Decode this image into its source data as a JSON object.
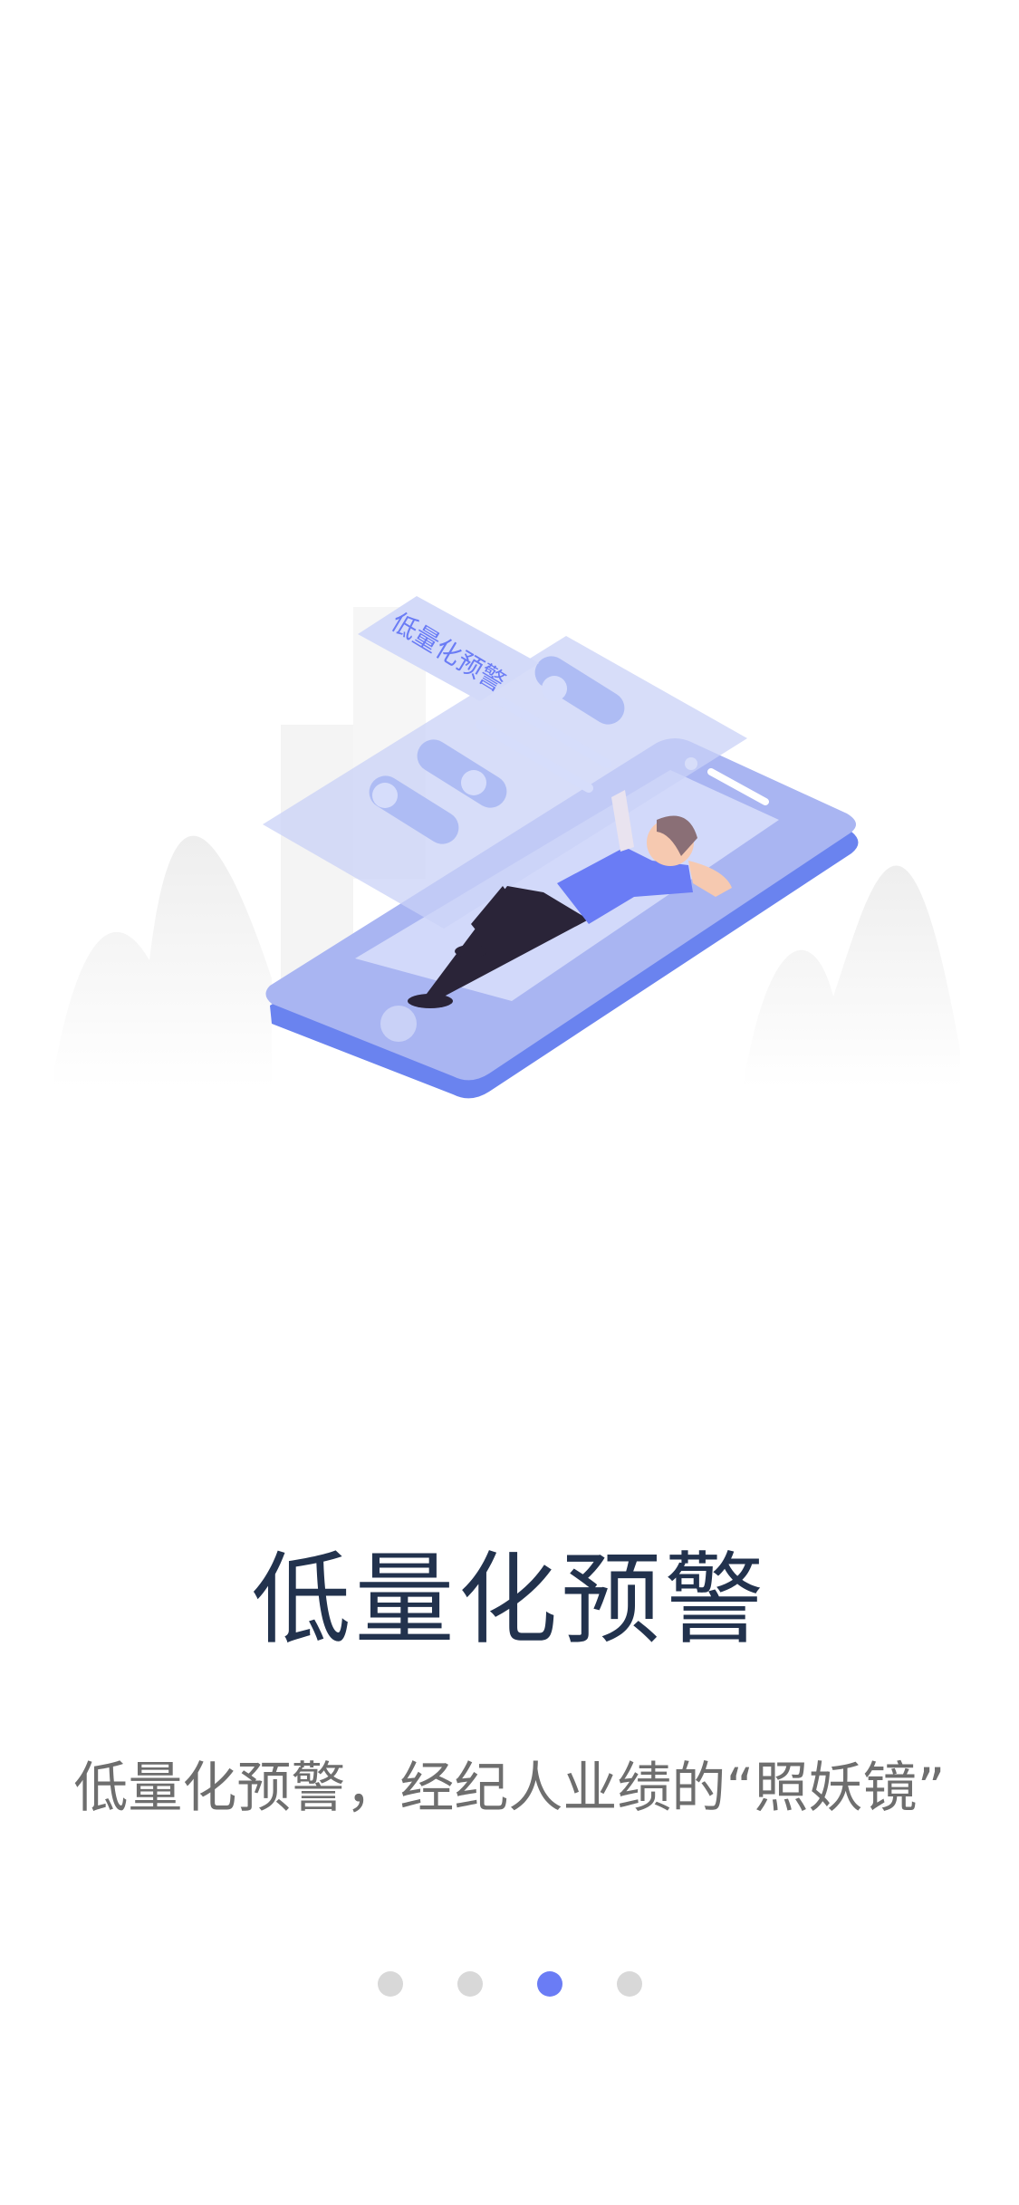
{
  "onboarding": {
    "illustration_label": "低量化预警",
    "title": "低量化预警",
    "subtitle": "低量化预警，经纪人业绩的“照妖镜”",
    "pager": {
      "total": 4,
      "active_index": 2
    }
  },
  "colors": {
    "accent": "#6a7cf5",
    "title": "#22324d",
    "subtitle": "#6e6e6e",
    "dot_inactive": "#d8d8d8"
  },
  "icons": [
    "phone-illustration",
    "person-illustration",
    "toggle-icon"
  ]
}
